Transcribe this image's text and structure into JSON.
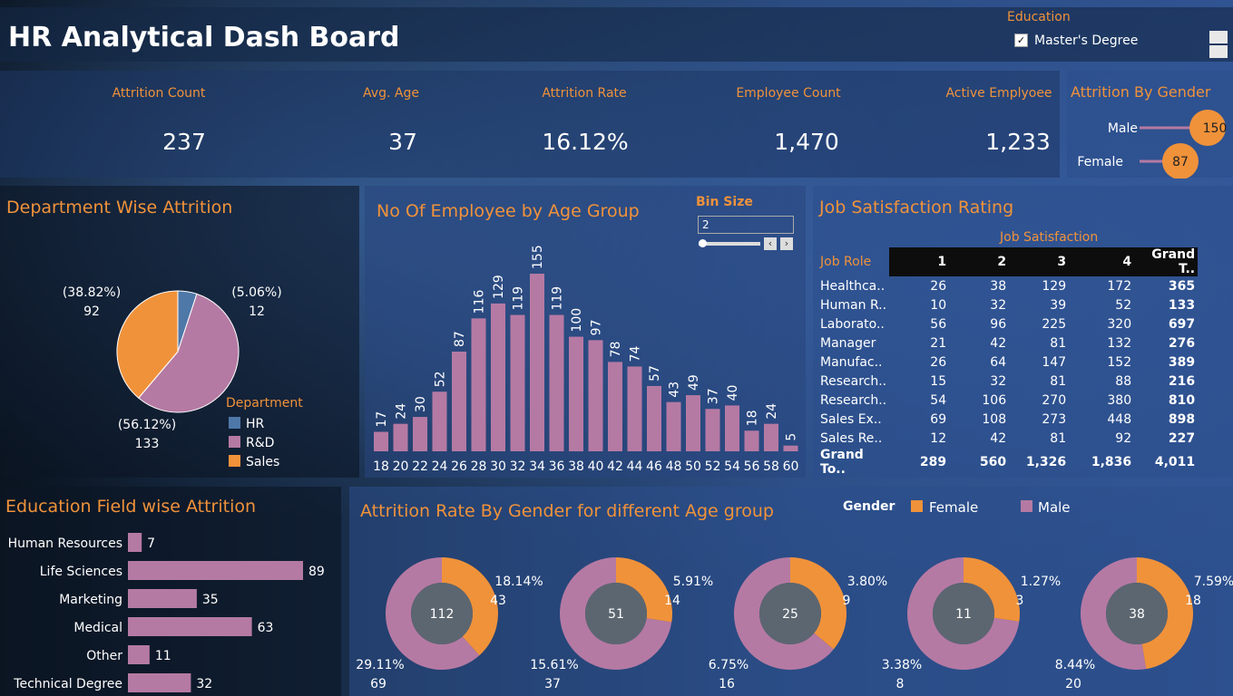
{
  "header": {
    "title": "HR Analytical Dash Board",
    "filter_label": "Education",
    "filter_value": "Master's Degree"
  },
  "kpis": [
    {
      "label": "Attrition Count",
      "value": "237"
    },
    {
      "label": "Avg. Age",
      "value": "37"
    },
    {
      "label": "Attrition Rate",
      "value": "16.12%"
    },
    {
      "label": "Employee Count",
      "value": "1,470"
    },
    {
      "label": "Active Emplyoee",
      "value": "1,233"
    }
  ],
  "gender_attr": {
    "title": "Attrition By Gender",
    "rows": [
      {
        "label": "Male",
        "value": 150
      },
      {
        "label": "Female",
        "value": 87
      }
    ]
  },
  "dept": {
    "title": "Department Wise Attrition",
    "legend_title": "Department",
    "labels": [
      {
        "pct": "(38.82%)",
        "val": "92"
      },
      {
        "pct": "(5.06%)",
        "val": "12"
      },
      {
        "pct": "(56.12%)",
        "val": "133"
      }
    ]
  },
  "age": {
    "title": "No Of Employee by Age Group",
    "bin_label": "Bin Size",
    "bin_value": "2"
  },
  "job": {
    "title": "Job Satisfaction Rating",
    "col_title": "Job Satisfaction",
    "role_header": "Job Role",
    "headers": [
      "1",
      "2",
      "3",
      "4",
      "Grand T.."
    ],
    "rows": [
      {
        "role": "Healthca..",
        "v": [
          "26",
          "38",
          "129",
          "172",
          "365"
        ]
      },
      {
        "role": "Human R..",
        "v": [
          "10",
          "32",
          "39",
          "52",
          "133"
        ]
      },
      {
        "role": "Laborato..",
        "v": [
          "56",
          "96",
          "225",
          "320",
          "697"
        ]
      },
      {
        "role": "Manager",
        "v": [
          "21",
          "42",
          "81",
          "132",
          "276"
        ]
      },
      {
        "role": "Manufac..",
        "v": [
          "26",
          "64",
          "147",
          "152",
          "389"
        ]
      },
      {
        "role": "Research..",
        "v": [
          "15",
          "32",
          "81",
          "88",
          "216"
        ]
      },
      {
        "role": "Research..",
        "v": [
          "54",
          "106",
          "270",
          "380",
          "810"
        ]
      },
      {
        "role": "Sales Ex..",
        "v": [
          "69",
          "108",
          "273",
          "448",
          "898"
        ]
      },
      {
        "role": "Sales Re..",
        "v": [
          "12",
          "42",
          "81",
          "92",
          "227"
        ]
      },
      {
        "role": "Grand To..",
        "v": [
          "289",
          "560",
          "1,326",
          "1,836",
          "4,011"
        ]
      }
    ]
  },
  "edu": {
    "title": "Education Field wise Attrition"
  },
  "donuts": {
    "title": "Attrition Rate By Gender for different Age group",
    "legend_title": "Gender"
  },
  "colors": {
    "orange": "#f0923a",
    "mauve": "#b57aa3",
    "blue": "#4e78a8",
    "center": "#5c6670"
  },
  "chart_data": [
    {
      "type": "pie",
      "title": "Department Wise Attrition",
      "legend": [
        "HR",
        "R&D",
        "Sales"
      ],
      "slices": [
        {
          "name": "HR",
          "value": 12,
          "pct": 5.06
        },
        {
          "name": "R&D",
          "value": 133,
          "pct": 56.12
        },
        {
          "name": "Sales",
          "value": 92,
          "pct": 38.82
        }
      ]
    },
    {
      "type": "bar",
      "title": "No Of Employee by Age Group",
      "categories": [
        "18",
        "20",
        "22",
        "24",
        "26",
        "28",
        "30",
        "32",
        "34",
        "36",
        "38",
        "40",
        "42",
        "44",
        "46",
        "48",
        "50",
        "52",
        "54",
        "56",
        "58",
        "60"
      ],
      "values": [
        17,
        24,
        30,
        52,
        87,
        116,
        129,
        119,
        155,
        119,
        100,
        97,
        78,
        74,
        57,
        43,
        49,
        37,
        40,
        18,
        24,
        5
      ]
    },
    {
      "type": "bar",
      "title": "Education Field wise Attrition",
      "categories": [
        "Human Resources",
        "Life Sciences",
        "Marketing",
        "Medical",
        "Other",
        "Technical Degree"
      ],
      "values": [
        7,
        89,
        35,
        63,
        11,
        32
      ]
    },
    {
      "type": "pie",
      "title": "Attrition Rate By Gender for different Age group",
      "legend": [
        "Female",
        "Male"
      ],
      "groups": [
        {
          "center": "112",
          "female": 43,
          "female_pct": "18.14%",
          "male": 69,
          "male_pct": "29.11%"
        },
        {
          "center": "51",
          "female": 14,
          "female_pct": "5.91%",
          "male": 37,
          "male_pct": "15.61%"
        },
        {
          "center": "25",
          "female": 9,
          "female_pct": "3.80%",
          "male": 16,
          "male_pct": "6.75%"
        },
        {
          "center": "11",
          "female": 3,
          "female_pct": "1.27%",
          "male": 8,
          "male_pct": "3.38%"
        },
        {
          "center": "38",
          "female": 18,
          "female_pct": "7.59%",
          "male": 20,
          "male_pct": "8.44%"
        }
      ]
    }
  ]
}
